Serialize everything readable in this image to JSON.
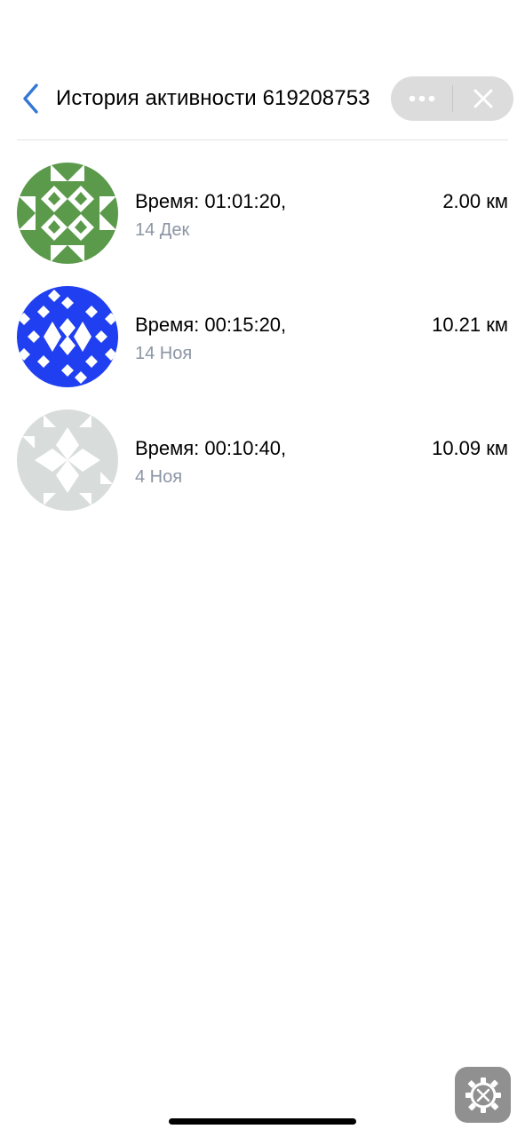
{
  "header": {
    "title": "История активности 619208753",
    "back_icon": "chevron-left-icon",
    "more_icon": "more-dots-icon",
    "close_icon": "close-icon",
    "accent_color": "#3478d6"
  },
  "activities": [
    {
      "time": "Время: 01:01:20,",
      "date": "14 Дек",
      "distance": "2.00 км",
      "avatar_color": "#5a9a4a"
    },
    {
      "time": "Время: 00:15:20,",
      "date": "14 Ноя",
      "distance": "10.21 км",
      "avatar_color": "#1f3ff0"
    },
    {
      "time": "Время: 00:10:40,",
      "date": "4 Ноя",
      "distance": "10.09 км",
      "avatar_color": "#d8dcdb"
    }
  ],
  "debug": {
    "icon": "gear-tools-icon"
  }
}
